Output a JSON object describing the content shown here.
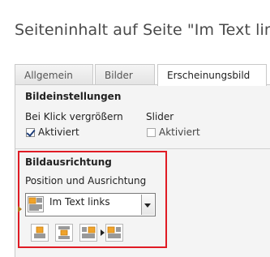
{
  "page": {
    "title": "Seiteninhalt auf Seite \"Im Text lin"
  },
  "tabs": [
    {
      "label": "Allgemein",
      "active": false
    },
    {
      "label": "Bilder",
      "active": false
    },
    {
      "label": "Erscheinungsbild",
      "active": true
    }
  ],
  "image_settings": {
    "header": "Bildeinstellungen",
    "click_enlarge": {
      "label": "Bei Klick vergrößern",
      "checkbox_label": "Aktiviert",
      "checked": true
    },
    "slider": {
      "label": "Slider",
      "checkbox_label": "Aktiviert",
      "checked": false
    }
  },
  "image_alignment": {
    "header": "Bildausrichtung",
    "position_label": "Position und Ausrichtung",
    "select": {
      "value": "Im Text links",
      "icon": "image-text-left-icon"
    },
    "options_icons": [
      "align-top-icon",
      "align-center-icon",
      "align-text-right-icon",
      "align-text-left-icon"
    ]
  },
  "colors": {
    "highlight": "#e01b24",
    "icon_orange": "#f0a32a",
    "icon_border": "#d98a10"
  }
}
